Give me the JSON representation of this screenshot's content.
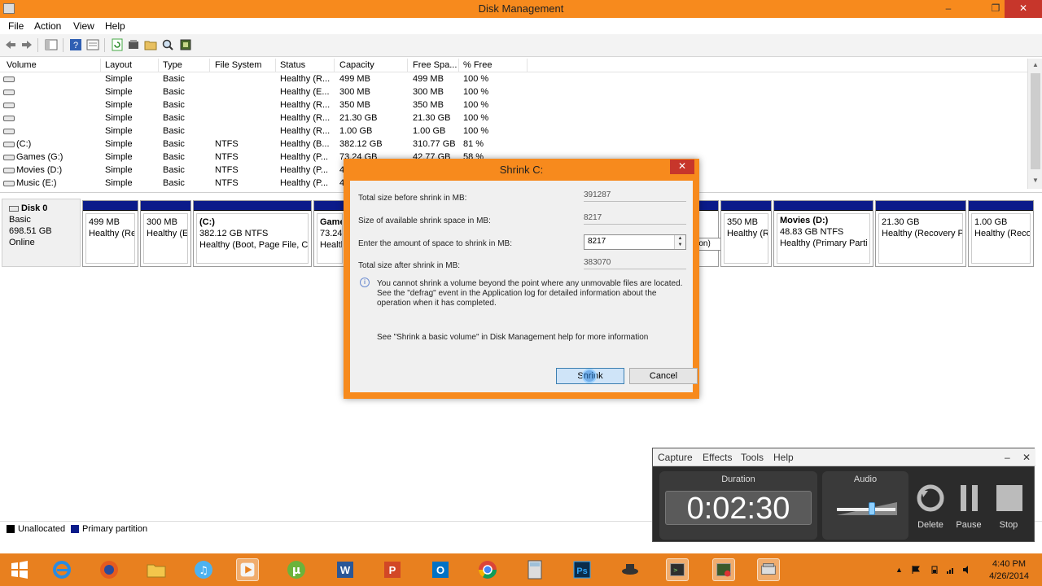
{
  "window": {
    "title": "Disk Management",
    "minimize": "–",
    "maximize": "❐",
    "close": "✕"
  },
  "menu": [
    "File",
    "Action",
    "View",
    "Help"
  ],
  "columns": [
    "Volume",
    "Layout",
    "Type",
    "File System",
    "Status",
    "Capacity",
    "Free Spa...",
    "% Free"
  ],
  "volumes": [
    {
      "volume": "",
      "layout": "Simple",
      "type": "Basic",
      "fs": "",
      "status": "Healthy (R...",
      "capacity": "499 MB",
      "free": "499 MB",
      "pct": "100 %"
    },
    {
      "volume": "",
      "layout": "Simple",
      "type": "Basic",
      "fs": "",
      "status": "Healthy (E...",
      "capacity": "300 MB",
      "free": "300 MB",
      "pct": "100 %"
    },
    {
      "volume": "",
      "layout": "Simple",
      "type": "Basic",
      "fs": "",
      "status": "Healthy (R...",
      "capacity": "350 MB",
      "free": "350 MB",
      "pct": "100 %"
    },
    {
      "volume": "",
      "layout": "Simple",
      "type": "Basic",
      "fs": "",
      "status": "Healthy (R...",
      "capacity": "21.30 GB",
      "free": "21.30 GB",
      "pct": "100 %"
    },
    {
      "volume": "",
      "layout": "Simple",
      "type": "Basic",
      "fs": "",
      "status": "Healthy (R...",
      "capacity": "1.00 GB",
      "free": "1.00 GB",
      "pct": "100 %"
    },
    {
      "volume": "(C:)",
      "layout": "Simple",
      "type": "Basic",
      "fs": "NTFS",
      "status": "Healthy (B...",
      "capacity": "382.12 GB",
      "free": "310.77 GB",
      "pct": "81 %"
    },
    {
      "volume": "Games (G:)",
      "layout": "Simple",
      "type": "Basic",
      "fs": "NTFS",
      "status": "Healthy (P...",
      "capacity": "73.24 GB",
      "free": "42.77 GB",
      "pct": "58 %"
    },
    {
      "volume": "Movies (D:)",
      "layout": "Simple",
      "type": "Basic",
      "fs": "NTFS",
      "status": "Healthy (P...",
      "capacity": "4",
      "free": "",
      "pct": ""
    },
    {
      "volume": "Music (E:)",
      "layout": "Simple",
      "type": "Basic",
      "fs": "NTFS",
      "status": "Healthy (P...",
      "capacity": "4",
      "free": "",
      "pct": ""
    }
  ],
  "disk": {
    "name": "Disk 0",
    "type": "Basic",
    "size": "698.51 GB",
    "state": "Online"
  },
  "partitions": [
    {
      "name": "",
      "size": "499 MB",
      "status": "Healthy (Re"
    },
    {
      "name": "",
      "size": "300 MB",
      "status": "Healthy (E"
    },
    {
      "name": "(C:)",
      "size": "382.12 GB NTFS",
      "status": "Healthy (Boot, Page File, C"
    },
    {
      "name": "Game",
      "size": "73.24 G",
      "status": "Health"
    },
    {
      "name": "",
      "size": "350 MB",
      "status": "Healthy (R"
    },
    {
      "name": "Movies  (D:)",
      "size": "48.83 GB NTFS",
      "status": "Healthy (Primary Parti"
    },
    {
      "name": "",
      "size": "21.30 GB",
      "status": "Healthy (Recovery P"
    },
    {
      "name": "",
      "size": "1.00 GB",
      "status": "Healthy (Reco"
    }
  ],
  "partial_tooltip": "rtition)",
  "legend": {
    "unallocated": "Unallocated",
    "primary": "Primary partition",
    "unallocated_color": "#000000",
    "primary_color": "#0b1b8a"
  },
  "dialog": {
    "title": "Shrink C:",
    "close": "✕",
    "total_before_label": "Total size before shrink in MB:",
    "total_before_value": "391287",
    "available_label": "Size of available shrink space in MB:",
    "available_value": "8217",
    "amount_label": "Enter the amount of space to shrink in MB:",
    "amount_value": "8217",
    "total_after_label": "Total size after shrink in MB:",
    "total_after_value": "383070",
    "info_line1": "You cannot shrink a volume beyond the point where any unmovable files are located.",
    "info_line2": "See the \"defrag\" event in the Application log for detailed information about the",
    "info_line3": "operation when it has completed.",
    "help_text": "See \"Shrink a basic volume\" in Disk Management help for more information",
    "shrink_label": "Shrink",
    "cancel_label": "Cancel",
    "info_icon": "i"
  },
  "recorder": {
    "menu": [
      "Capture",
      "Effects",
      "Tools",
      "Help"
    ],
    "minimize": "–",
    "close": "✕",
    "duration_label": "Duration",
    "duration": "0:02:30",
    "audio_label": "Audio",
    "audio_level": 0.6,
    "delete_label": "Delete",
    "pause_label": "Pause",
    "stop_label": "Stop"
  },
  "clock": {
    "time": "4:40 PM",
    "date": "4/26/2014"
  },
  "colors": {
    "accent": "#f78a1d",
    "taskbar": "#e8801f",
    "close": "#c7362b",
    "primary_partition": "#0b1b8a"
  }
}
